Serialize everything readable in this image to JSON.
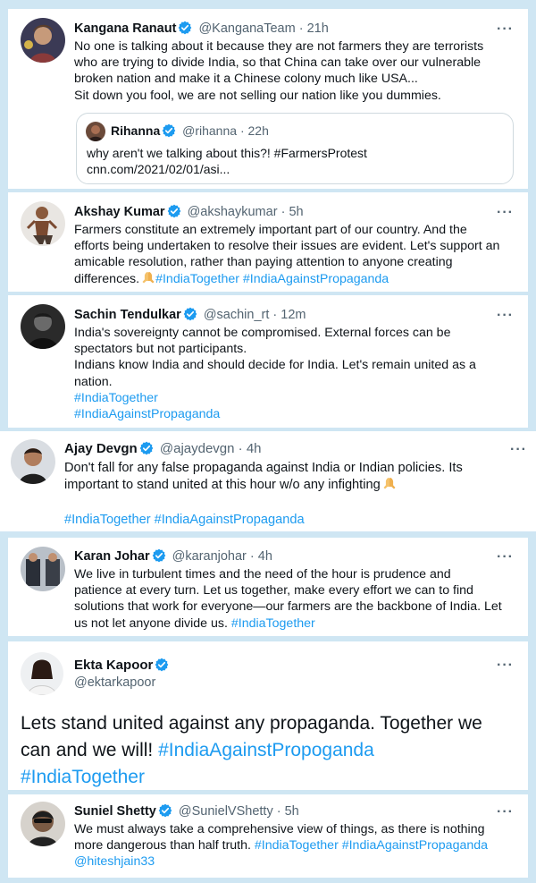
{
  "accent": "#1d9bf0",
  "verified_color": "#1d9bf0",
  "tweets": [
    {
      "name": "Kangana Ranaut",
      "handle": "@KanganaTeam",
      "dot": "·",
      "time": "21h",
      "more": "···",
      "lines": [
        "No one is talking about it because they are not farmers they are terrorists",
        "who are trying to divide India, so that China can take over our vulnerable",
        "broken nation and make it a Chinese colony much like USA...",
        "Sit down you fool, we are not selling our nation like you dummies."
      ],
      "quote": {
        "name": "Rihanna",
        "handle": "@rihanna",
        "dot": "·",
        "time": "22h",
        "text": "why aren't we talking about this?! #FarmersProtest",
        "link": "cnn.com/2021/02/01/asi..."
      }
    },
    {
      "name": "Akshay Kumar",
      "handle": "@akshaykumar",
      "dot": "·",
      "time": "5h",
      "more": "···",
      "lines": [
        "Farmers constitute an extremely important part of our country. And the",
        "efforts being undertaken to resolve their issues are evident. Let's support an",
        "amicable resolution, rather than paying attention to anyone creating"
      ],
      "last_line_text": "differences.",
      "hashtags": "#IndiaTogether #IndiaAgainstPropaganda"
    },
    {
      "name": "Sachin Tendulkar",
      "handle": "@sachin_rt",
      "dot": "·",
      "time": "12m",
      "more": "···",
      "lines": [
        "India's sovereignty cannot be compromised. External forces can be",
        "spectators but not participants.",
        "Indians know India and should decide for India. Let's remain united as a",
        "nation."
      ],
      "hashtag_lines": [
        "#IndiaTogether",
        "#IndiaAgainstPropaganda"
      ]
    },
    {
      "name": "Ajay Devgn",
      "handle": "@ajaydevgn",
      "dot": "·",
      "time": "4h",
      "more": "···",
      "lines": [
        "Don't fall for any false propaganda against India or Indian policies. Its",
        "important to stand united at this hour w/o any infighting"
      ],
      "hashtags": "#IndiaTogether #IndiaAgainstPropaganda"
    },
    {
      "name": "Karan Johar",
      "handle": "@karanjohar",
      "dot": "·",
      "time": "4h",
      "more": "···",
      "lines": [
        "We live in turbulent times and the need of the hour is prudence and",
        "patience at every turn. Let us together, make every effort we can to find",
        "solutions that work for everyone—our farmers are the backbone of India. Let"
      ],
      "last_line_text": "us not let anyone divide us.",
      "hashtags": "#IndiaTogether"
    },
    {
      "name": "Ekta Kapoor",
      "handle": "@ektarkapoor",
      "more": "···",
      "lines": [
        "Lets stand united against any propaganda. Together we",
        "can and we will!"
      ],
      "inline_tag": "#IndiaAgainstPropoganda",
      "hashtags": "#IndiaTogether"
    },
    {
      "name": "Suniel Shetty",
      "handle": "@SunielVShetty",
      "dot": "·",
      "time": "5h",
      "more": "···",
      "lines": [
        "We must always take a comprehensive view of things, as there is nothing"
      ],
      "line2_text": "more dangerous than half truth.",
      "line2_tags": "#IndiaTogether #IndiaAgainstPropaganda",
      "mention": "@hiteshjain33"
    }
  ]
}
